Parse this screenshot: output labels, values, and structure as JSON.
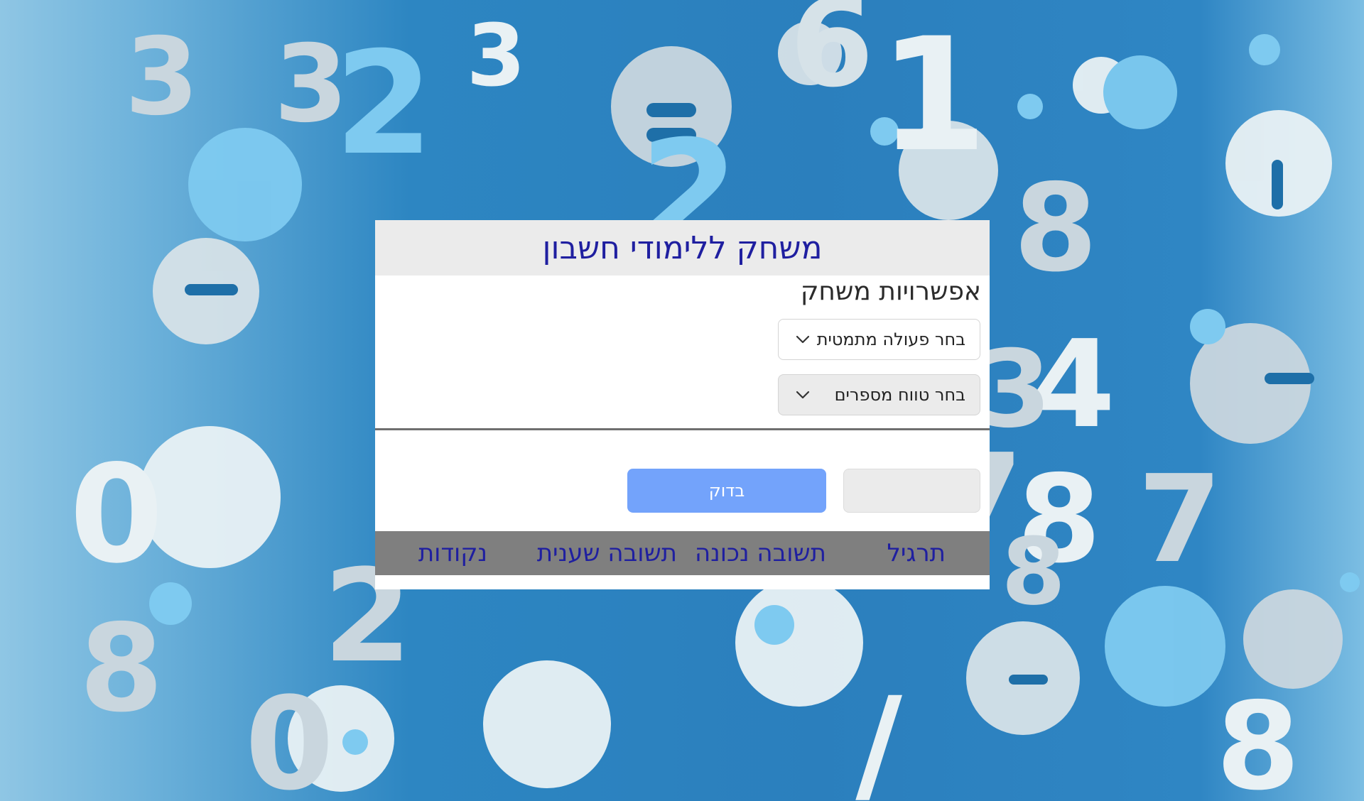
{
  "game": {
    "title": "משחק ללימודי חשבון",
    "options_heading": "אפשרויות משחק",
    "operation_select": {
      "placeholder": "בחר פעולה מתמטית",
      "icon": "chevron-down-icon"
    },
    "range_select": {
      "placeholder": "בחר טווח מספרים",
      "icon": "chevron-down-icon"
    },
    "answer_input": {
      "value": "",
      "placeholder": ""
    },
    "check_button": {
      "label": "בדוק",
      "color": "#73a3fb"
    }
  },
  "stats": {
    "exercise": "תרגיל",
    "correct_answer": "תשובה נכונה",
    "second_answer": "תשובה שענית",
    "points": "נקודות"
  },
  "colors": {
    "title_text": "#1f1fa0",
    "title_bar_bg": "#ebebeb",
    "stats_bar_bg": "#7f7f7f",
    "background_accent": "#2b7fbd"
  }
}
